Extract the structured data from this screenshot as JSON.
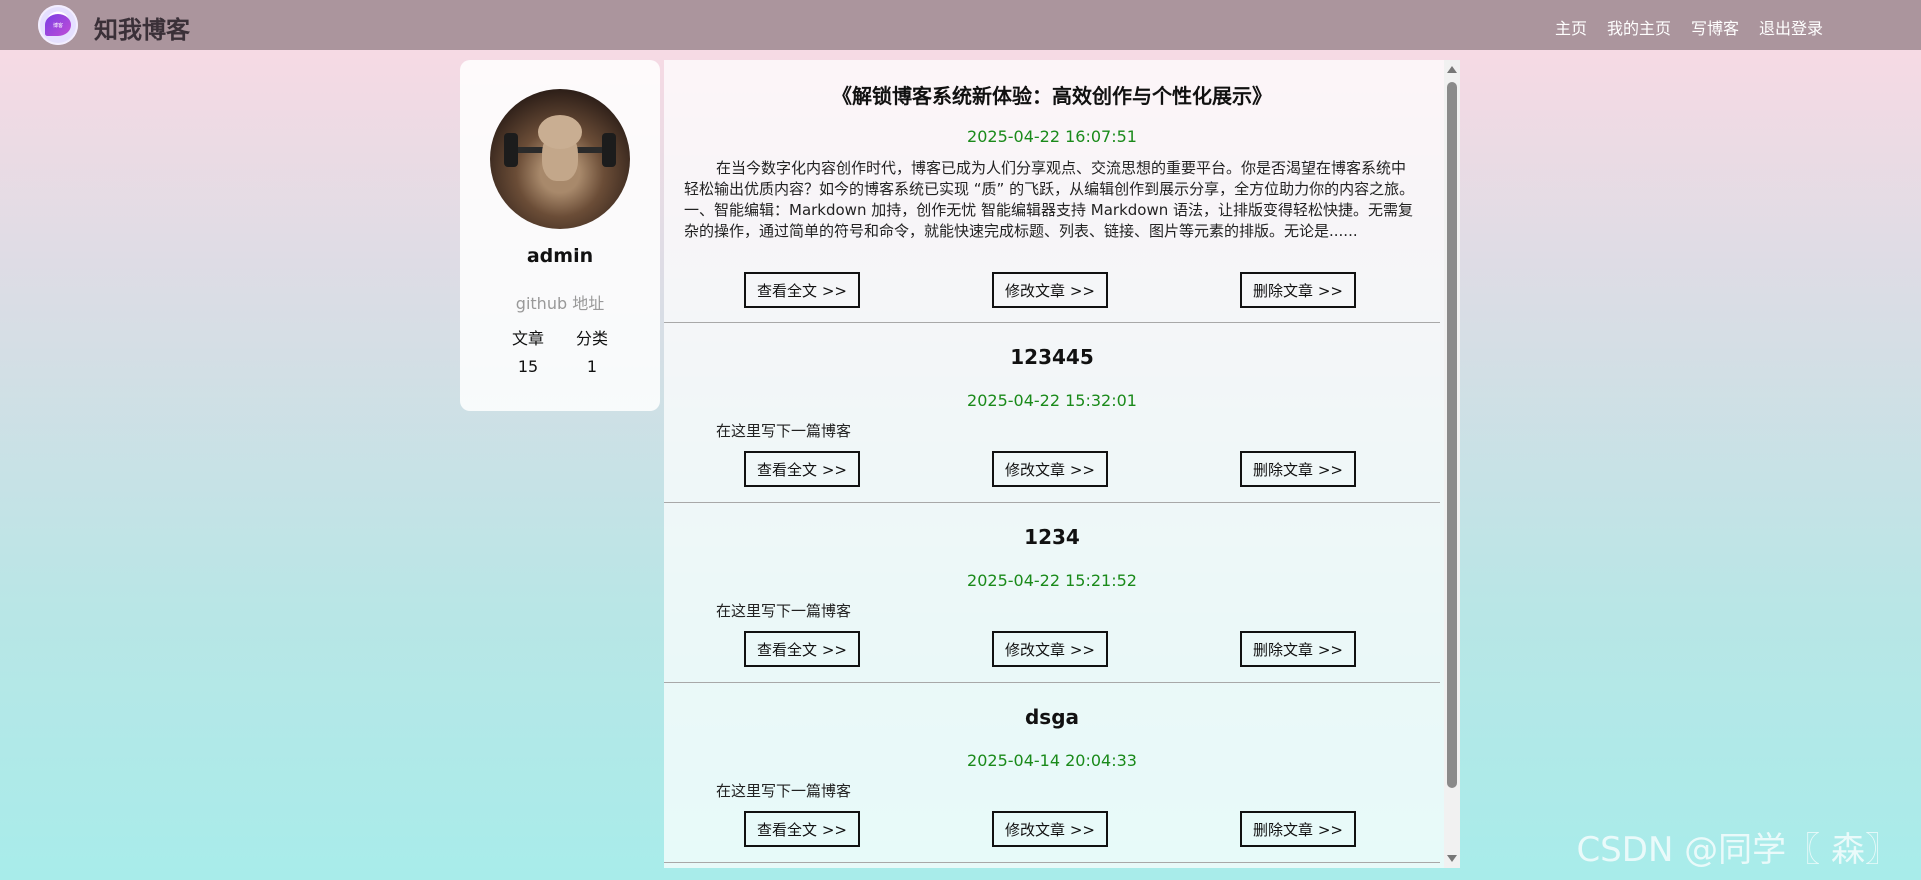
{
  "nav": {
    "brand": "知我博客",
    "logo_text": "博客",
    "links": [
      "主页",
      "我的主页",
      "写博客",
      "退出登录"
    ]
  },
  "profile": {
    "username": "admin",
    "github": "github 地址",
    "stats_labels": [
      "文章",
      "分类"
    ],
    "stats_values": [
      "15",
      "1"
    ]
  },
  "buttons": {
    "view": "查看全文 >>",
    "edit": "修改文章 >>",
    "delete": "删除文章 >>"
  },
  "articles": [
    {
      "title": "《解锁博客系统新体验：高效创作与个性化展示》",
      "date": "2025-04-22 16:07:51",
      "desc": "在当今数字化内容创作时代，博客已成为人们分享观点、交流思想的重要平台。你是否渴望在博客系统中轻松输出优质内容？如今的博客系统已实现 “质” 的飞跃，从编辑创作到展示分享，全方位助力你的内容之旅。 一、智能编辑：Markdown 加持，创作无忧 智能编辑器支持 Markdown 语法，让排版变得轻松快捷。无需复杂的操作，通过简单的符号和命令，就能快速完成标题、列表、链接、图片等元素的排版。无论是......"
    },
    {
      "title": "123445",
      "date": "2025-04-22 15:32:01",
      "desc": "在这里写下一篇博客"
    },
    {
      "title": "1234",
      "date": "2025-04-22 15:21:52",
      "desc": "在这里写下一篇博客"
    },
    {
      "title": "dsga",
      "date": "2025-04-14 20:04:33",
      "desc": "在这里写下一篇博客"
    }
  ],
  "watermark": "CSDN @同学〖 森〗"
}
